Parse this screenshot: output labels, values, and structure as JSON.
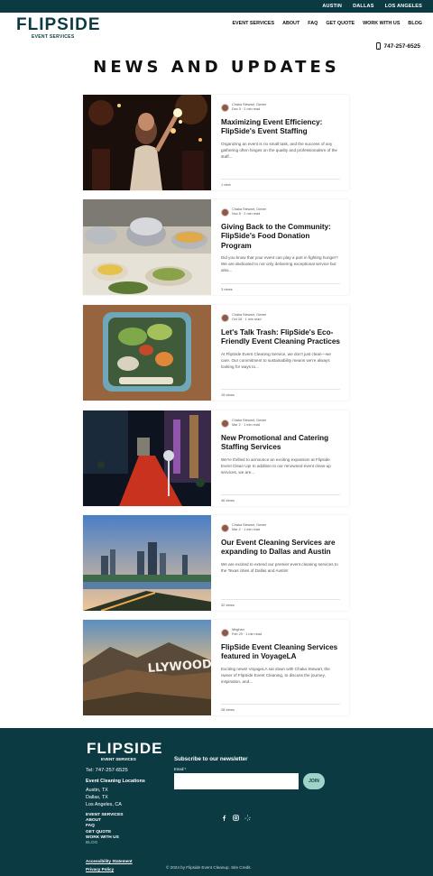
{
  "topbar": {
    "cities": [
      "AUSTIN",
      "DALLAS",
      "LOS ANGELES"
    ]
  },
  "header": {
    "logo_text": "FLIPSIDE",
    "logo_subtext": "EVENT SERVICES",
    "nav": [
      "EVENT SERVICES",
      "ABOUT",
      "FAQ",
      "GET QUOTE",
      "WORK WITH US",
      "BLOG"
    ],
    "phone": "747-257-6525",
    "phone_icon": "phone-icon"
  },
  "page_title": "NEWS AND UPDATES",
  "posts": [
    {
      "author": "Chaka Stewart, Owner",
      "date_read": "Dec 3  ·  2 min read",
      "title": "Maximizing Event Efficiency: FlipSide's Event Staffing",
      "excerpt": "Organizing an event is no small task, and the success of any gathering often hinges on the quality and professionalism of the staff...",
      "stats": "1 view"
    },
    {
      "author": "Chaka Stewart, Owner",
      "date_read": "Nov 5  ·  2 min read",
      "title": "Giving Back to the Community: FlipSide's Food Donation Program",
      "excerpt": "Did you know that your event can play a part in fighting hunger? We are dedicated to not only delivering exceptional service but also...",
      "stats": "3 views"
    },
    {
      "author": "Chaka Stewart, Owner",
      "date_read": "Oct 26  ·  1 min read",
      "title": "Let's Talk Trash: FlipSide's Eco-Friendly Event Cleaning Practices",
      "excerpt": "At FlipSide Event Cleaning Service, we don't just clean—we care. Our commitment to sustainability means we're always looking for ways to...",
      "stats": "15 views"
    },
    {
      "author": "Chaka Stewart, Owner",
      "date_read": "Mar 2  ·  1 min read",
      "title": "New Promotional and Catering Staffing Services",
      "excerpt": "We're thrilled to announce an exciting expansion at Flipside Event Clean Up! In addition to our renowned event clean-up services, we are...",
      "stats": "46 views"
    },
    {
      "author": "Chaka Stewart, Owner",
      "date_read": "Mar 2  ·  1 min read",
      "title": "Our Event Cleaning Services are expanding to Dallas and Austin",
      "excerpt": "We are excited to extend our premier event cleaning services to the Texas cities of Dallas and Austin!",
      "stats": "32 views"
    },
    {
      "author": "Meghan",
      "date_read": "Feb 29  ·  1 min read",
      "title": "FlipSide Event Cleaning Services featured in VoyageLA",
      "excerpt": "Exciting news! VoyageLA sat down with Chaka Stewart, the owner of FlipSide Event Cleaning, to discuss the journey, inspiration, and...",
      "stats": "28 views"
    }
  ],
  "footer": {
    "logo_text": "FLIPSIDE",
    "logo_subtext": "EVENT SERVICES",
    "tel": "Tel: 747-257-6525",
    "locations_heading": "Event Cleaning Locations",
    "locations": [
      "Austin, TX",
      "Dallas, TX",
      "Los Angeles, CA"
    ],
    "links": [
      "EVENT SERVICES",
      "ABOUT",
      "FAQ",
      "GET QUOTE",
      "WORK WITH US",
      "BLOG"
    ],
    "active_link": "BLOG",
    "legal": [
      "Accessibility Statement",
      "Privacy Policy"
    ],
    "newsletter_heading": "Subscribe to our newsletter",
    "email_label": "Email *",
    "email_value": "",
    "join_label": "JOIN",
    "social_icons": [
      "facebook-icon",
      "instagram-icon",
      "yelp-icon"
    ],
    "copyright": "© 2024 by Flipside Event Cleanup. Site Credit."
  },
  "colors": {
    "brand": "#0b3a43",
    "accent": "#9fd3c7"
  }
}
